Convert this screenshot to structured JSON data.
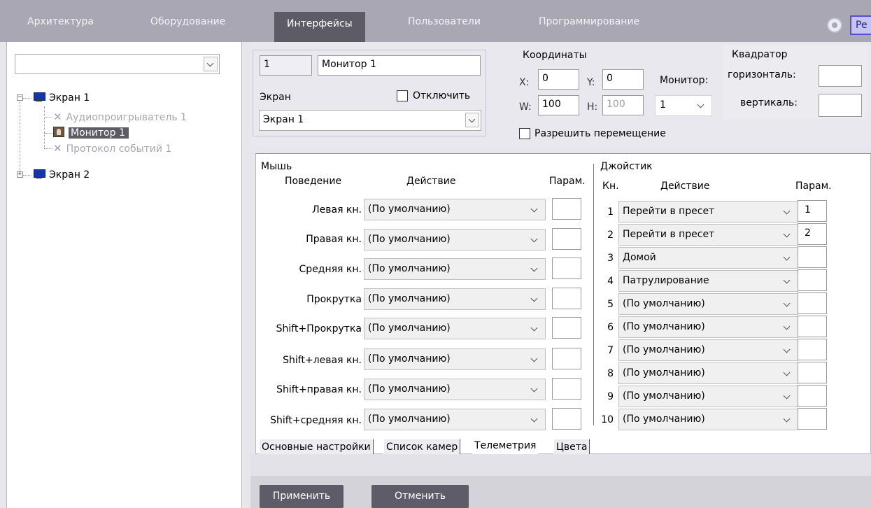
{
  "top_tabs": [
    "Архитектура",
    "Оборудование",
    "Интерфейсы",
    "Пользователи",
    "Программирование"
  ],
  "active_top_tab": "Интерфейсы",
  "top_right_button_label": "Pe",
  "tree": {
    "combo_value": "",
    "items": [
      {
        "label": "Экран 1",
        "expander": "−"
      },
      {
        "label": "Аудиопроигрыватель 1"
      },
      {
        "label": "Монитор 1"
      },
      {
        "label": "Протокол событий 1"
      },
      {
        "label": "Экран 2",
        "expander": "+"
      }
    ]
  },
  "object": {
    "id": "1",
    "name": "Монитор 1",
    "screen_label": "Экран",
    "disable_label": "Отключить",
    "screen_value": "Экран 1"
  },
  "coords": {
    "title": "Координаты",
    "x_label": "X:",
    "x_value": "0",
    "y_label": "Y:",
    "y_value": "0",
    "w_label": "W:",
    "w_value": "100",
    "h_label": "H:",
    "h_value": "100",
    "monitor_label": "Монитор:",
    "monitor_value": "1",
    "allow_move_label": "Разрешить перемещение"
  },
  "quad": {
    "title": "Квадратор",
    "horizontal_label": "горизонталь:",
    "vertical_label": "вертикаль:",
    "horizontal_value": "",
    "vertical_value": ""
  },
  "mouse": {
    "title": "Мышь",
    "col_behavior": "Поведение",
    "col_action": "Действие",
    "col_param": "Парам.",
    "rows": [
      {
        "label": "Левая кн.",
        "action": "(По умолчанию)",
        "param": ""
      },
      {
        "label": "Правая кн.",
        "action": "(По умолчанию)",
        "param": ""
      },
      {
        "label": "Средняя кн.",
        "action": "(По умолчанию)",
        "param": ""
      },
      {
        "label": "Прокрутка",
        "action": "(По умолчанию)",
        "param": ""
      },
      {
        "label": "Shift+Прокрутка",
        "action": "(По умолчанию)",
        "param": ""
      },
      {
        "label": "Shift+левая кн.",
        "action": "(По умолчанию)",
        "param": ""
      },
      {
        "label": "Shift+правая кн.",
        "action": "(По умолчанию)",
        "param": ""
      },
      {
        "label": "Shift+средняя кн.",
        "action": "(По умолчанию)",
        "param": ""
      }
    ]
  },
  "joystick": {
    "title": "Джойстик",
    "col_button": "Кн.",
    "col_action": "Действие",
    "col_param": "Парам.",
    "rows": [
      {
        "num": "1",
        "action": "Перейти в пресет",
        "param": "1"
      },
      {
        "num": "2",
        "action": "Перейти в пресет",
        "param": "2"
      },
      {
        "num": "3",
        "action": "Домой",
        "param": ""
      },
      {
        "num": "4",
        "action": "Патрулирование",
        "param": ""
      },
      {
        "num": "5",
        "action": "(По умолчанию)",
        "param": ""
      },
      {
        "num": "6",
        "action": "(По умолчанию)",
        "param": ""
      },
      {
        "num": "7",
        "action": "(По умолчанию)",
        "param": ""
      },
      {
        "num": "8",
        "action": "(По умолчанию)",
        "param": ""
      },
      {
        "num": "9",
        "action": "(По умолчанию)",
        "param": ""
      },
      {
        "num": "10",
        "action": "(По умолчанию)",
        "param": ""
      }
    ]
  },
  "bottom_tabs": [
    "Основные настройки",
    "Список камер",
    "Телеметрия",
    "Цвета"
  ],
  "active_bottom_tab": "Телеметрия",
  "buttons": {
    "apply": "Применить",
    "cancel": "Отменить"
  }
}
